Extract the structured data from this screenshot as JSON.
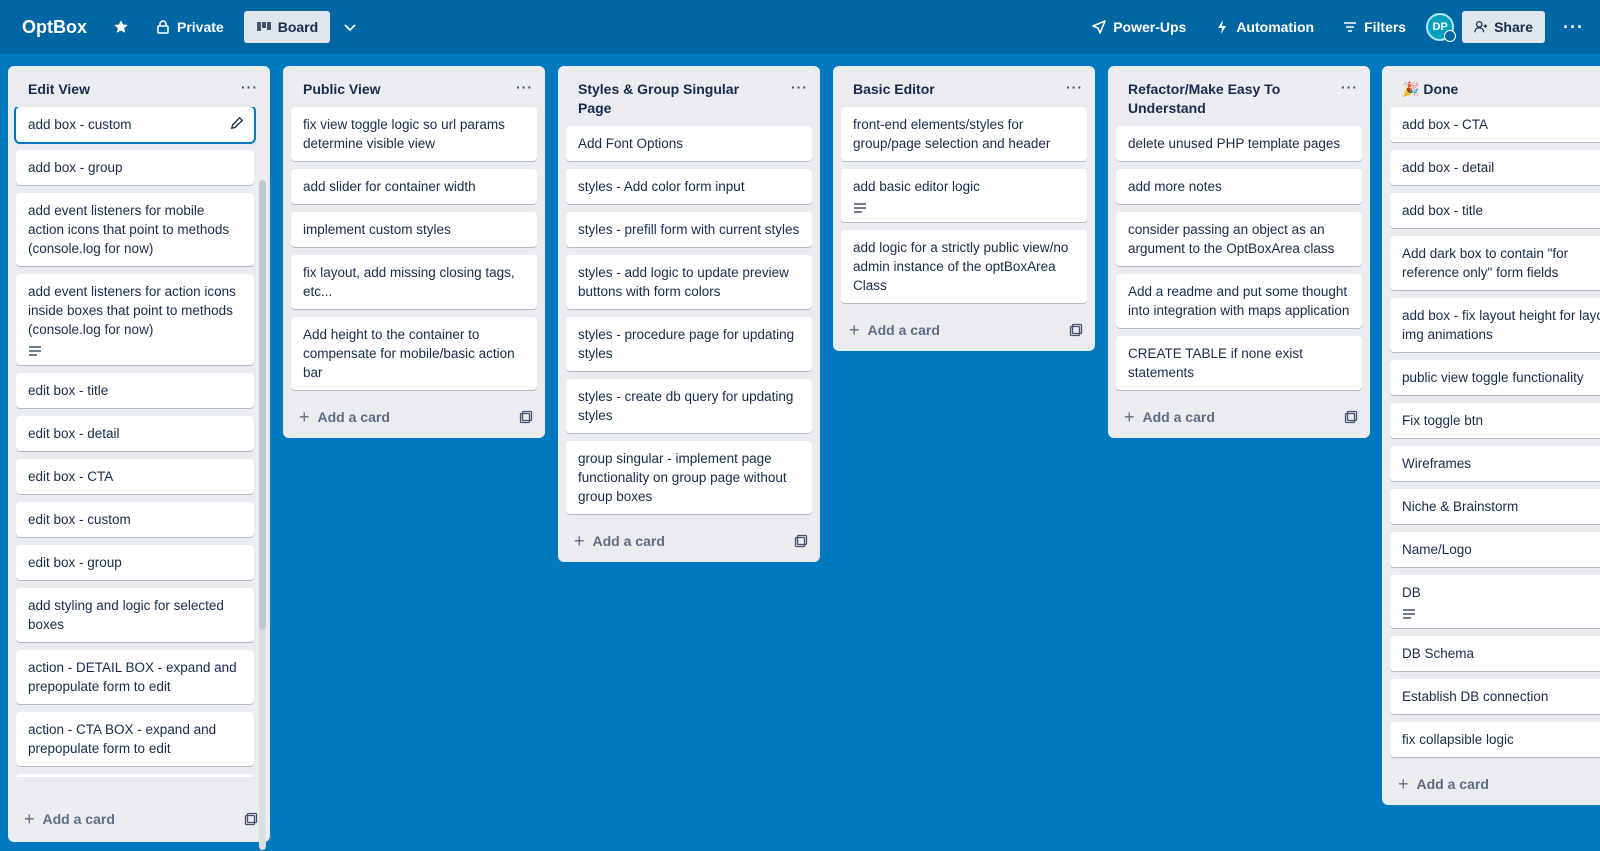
{
  "header": {
    "board_title": "OptBox",
    "visibility": "Private",
    "view": "Board",
    "power_ups": "Power-Ups",
    "automation": "Automation",
    "filters": "Filters",
    "avatar_initials": "DP",
    "share": "Share"
  },
  "add_card_label": "Add a card",
  "lists": [
    {
      "title": "Edit View",
      "cards": [
        {
          "text": "add box - custom"
        },
        {
          "text": "add box - group"
        },
        {
          "text": "add event listeners for mobile action icons that point to methods (console.log for now)"
        },
        {
          "text": "add event listeners for action icons inside boxes that point to methods (console.log for now)"
        },
        {
          "text": "edit box - title"
        },
        {
          "text": "edit box - detail"
        },
        {
          "text": "edit box - CTA"
        },
        {
          "text": "edit box - custom"
        },
        {
          "text": "edit box - group"
        },
        {
          "text": "add styling and logic for selected boxes"
        },
        {
          "text": "action - DETAIL BOX - expand and prepopulate form to edit"
        },
        {
          "text": "action - CTA BOX - expand and prepopulate form to edit"
        },
        {
          "text": ""
        }
      ]
    },
    {
      "title": "Public View",
      "cards": [
        {
          "text": "fix view toggle logic so url params determine visible view"
        },
        {
          "text": "add slider for container width"
        },
        {
          "text": "implement custom styles"
        },
        {
          "text": "fix layout, add missing closing tags, etc..."
        },
        {
          "text": "Add height to the container to compensate for mobile/basic action bar"
        }
      ]
    },
    {
      "title": "Styles & Group Singular Page",
      "cards": [
        {
          "text": "Add Font Options"
        },
        {
          "text": "styles - Add color form input"
        },
        {
          "text": "styles - prefill form with current styles"
        },
        {
          "text": "styles - add logic to update preview buttons with form colors"
        },
        {
          "text": "styles - procedure page for updating styles"
        },
        {
          "text": "styles - create db query for updating styles"
        },
        {
          "text": "group singular - implement page functionality on group page without group boxes"
        }
      ]
    },
    {
      "title": "Basic Editor",
      "cards": [
        {
          "text": "front-end elements/styles for group/page selection and header"
        },
        {
          "text": "add basic editor logic"
        },
        {
          "text": "add logic for a strictly public view/no admin instance of the optBoxArea Class"
        }
      ]
    },
    {
      "title": "Refactor/Make Easy To Understand",
      "cards": [
        {
          "text": "delete unused PHP template pages"
        },
        {
          "text": "add more notes"
        },
        {
          "text": "consider passing an object as an argument to the OptBoxArea class"
        },
        {
          "text": "Add a readme and put some thought into integration with maps application"
        },
        {
          "text": "CREATE TABLE if none exist statements"
        }
      ]
    },
    {
      "title": "Done",
      "emoji": "🎉",
      "cards": [
        {
          "text": "add box - CTA"
        },
        {
          "text": "add box - detail"
        },
        {
          "text": "add box - title"
        },
        {
          "text": "Add dark box to contain \"for reference only\" form fields"
        },
        {
          "text": "add box - fix layout height for layo img animations"
        },
        {
          "text": "public view toggle functionality"
        },
        {
          "text": "Fix toggle btn"
        },
        {
          "text": "Wireframes"
        },
        {
          "text": "Niche & Brainstorm"
        },
        {
          "text": "Name/Logo"
        },
        {
          "text": "DB"
        },
        {
          "text": "DB Schema"
        },
        {
          "text": "Establish DB connection"
        },
        {
          "text": "fix collapsible logic"
        }
      ]
    }
  ]
}
